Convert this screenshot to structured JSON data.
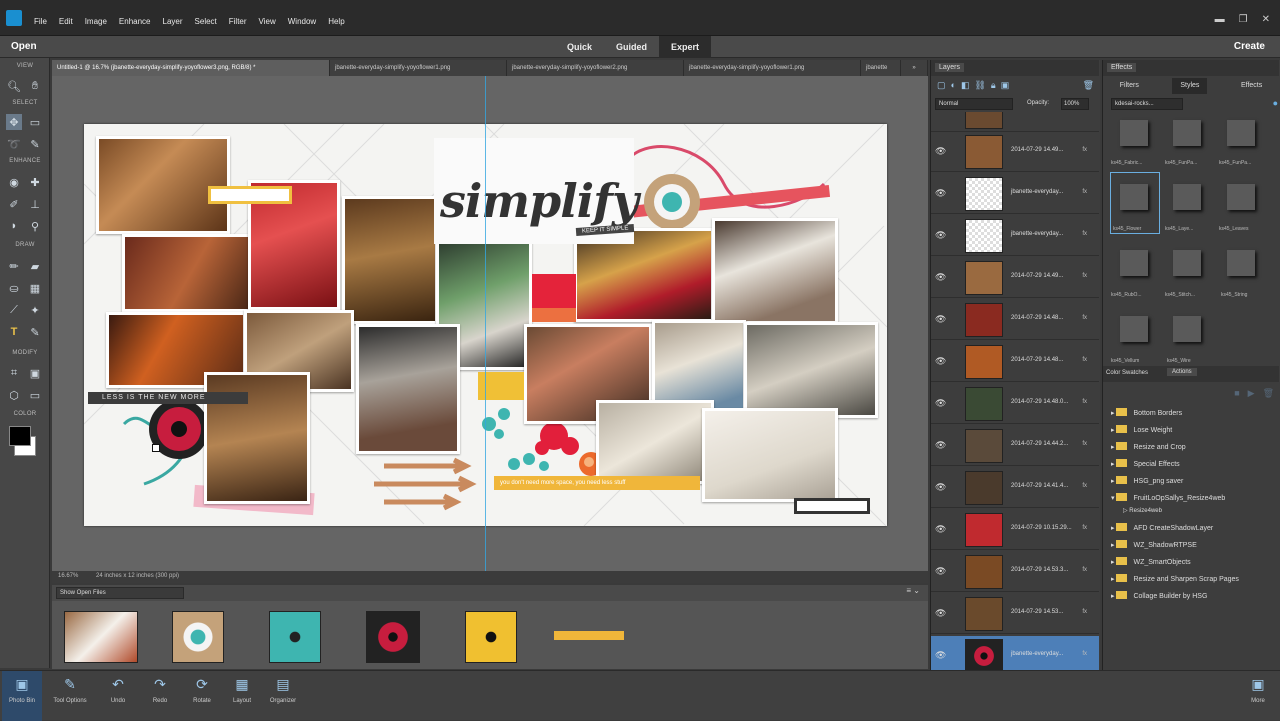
{
  "menu": {
    "items": [
      "File",
      "Edit",
      "Image",
      "Enhance",
      "Layer",
      "Select",
      "Filter",
      "View",
      "Window",
      "Help"
    ]
  },
  "modebar": {
    "open": "Open",
    "modes": [
      "Quick",
      "Guided",
      "Expert"
    ],
    "active": "Expert",
    "create": "Create"
  },
  "toolbox": {
    "sections": [
      "VIEW",
      "SELECT",
      "ENHANCE",
      "DRAW",
      "MODIFY",
      "COLOR"
    ]
  },
  "tabs": [
    "Untitled-1 @ 16.7% (jbanette-everyday-simplify-yoyoflower3.png, RGB/8) *",
    "jbanette-everyday-simplify-yoyoflower1.png",
    "jbanette-everyday-simplify-yoyoflower2.png",
    "jbanette-everyday-simplify-yoyoflower1.png",
    "jbanette"
  ],
  "document": {
    "title": "simplify",
    "stamp": "KEEP IT SIMPLE",
    "label": "LESS IS THE NEW MORE",
    "quote": "you don't need more space, you need less stuff"
  },
  "status": {
    "zoom": "16.67%",
    "size": "24 inches x 12 inches (300 ppi)"
  },
  "bin": {
    "dropdown": "Show Open Files"
  },
  "bottom": {
    "buttons": [
      "Photo Bin",
      "Tool Options",
      "Undo",
      "Redo",
      "Rotate",
      "Layout",
      "Organizer"
    ],
    "more": "More"
  },
  "layers": {
    "title": "Layers",
    "blend": "Normal",
    "opacity_label": "Opacity:",
    "opacity": "100%",
    "rows": [
      {
        "name": "2014-07-29 14.49...",
        "fx": "fx"
      },
      {
        "name": "jbanette-everyday...",
        "fx": "fx"
      },
      {
        "name": "jbanette-everyday...",
        "fx": "fx"
      },
      {
        "name": "2014-07-29 14.49...",
        "fx": "fx"
      },
      {
        "name": "2014-07-29 14.48...",
        "fx": "fx"
      },
      {
        "name": "2014-07-29 14.48...",
        "fx": "fx"
      },
      {
        "name": "2014-07-29 14.48.0...",
        "fx": "fx"
      },
      {
        "name": "2014-07-29 14.44.2...",
        "fx": "fx"
      },
      {
        "name": "2014-07-29 14.41.4...",
        "fx": "fx"
      },
      {
        "name": "2014-07-29 10.15.29...",
        "fx": "fx"
      },
      {
        "name": "2014-07-29 14.53.3...",
        "fx": "fx"
      },
      {
        "name": "2014-07-29 14.53...",
        "fx": "fx"
      },
      {
        "name": "jbanette-everyday...",
        "fx": "fx"
      }
    ]
  },
  "effects": {
    "title": "Effects",
    "tabs": [
      "Filters",
      "Styles",
      "Effects"
    ],
    "active_tab": "Styles",
    "dropdown": "kdesai-rocks...",
    "styles": [
      "ks45_Fabric...",
      "ks45_FunPa...",
      "ks45_FunPa...",
      "ks45_Flower",
      "ks45_Laye...",
      "ks45_Leaves",
      "ks45_RubO...",
      "ks45_Stitch...",
      "ks45_String",
      "ks45_Vellum",
      "ks45_Wire"
    ]
  },
  "actions": {
    "tabs": [
      "Color Swatches",
      "Actions"
    ],
    "active_tab": "Actions",
    "items": [
      "Bottom Borders",
      "Lose Weight",
      "Resize and Crop",
      "Special Effects",
      "HSG_png saver",
      "FruitLoOpSallys_Resize4web",
      "Resize4web",
      "AFD CreateShadowLayer",
      "WZ_ShadowRTPSE",
      "WZ_SmartObjects",
      "Resize and Sharpen Scrap Pages",
      "Collage Builder by HSG"
    ]
  }
}
